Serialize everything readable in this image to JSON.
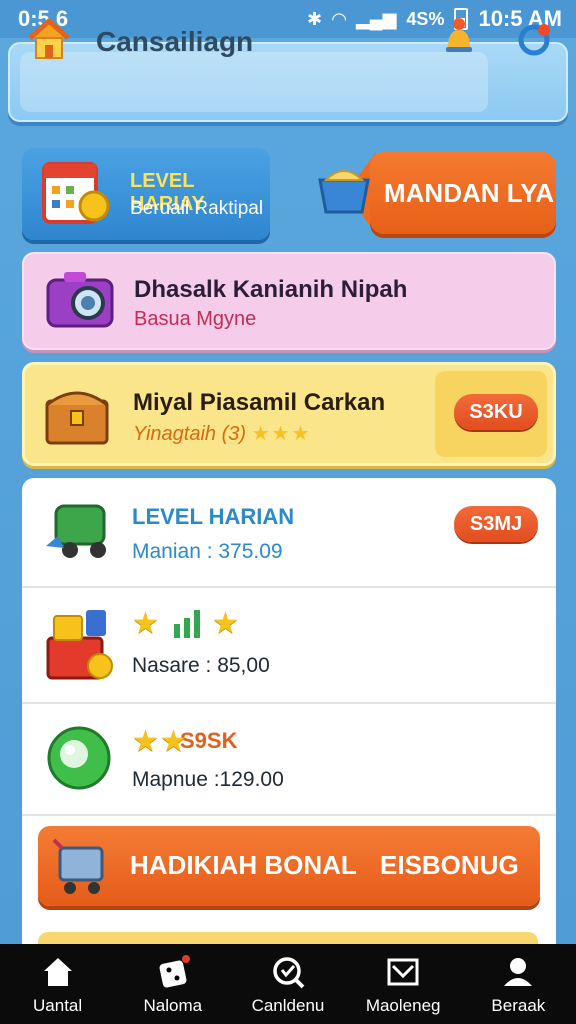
{
  "status_bar": {
    "time_left": "0:5 6",
    "battery": "4S%",
    "time_right": "10:5 AM"
  },
  "header": {
    "title": "Cansailiagn"
  },
  "level_card": {
    "title": "LEVEL HARIAY",
    "subtitle": "Beruail Raktipal"
  },
  "mandan_button": {
    "label": "MANDAN LYA"
  },
  "pink_card": {
    "title": "Dhasalk Kanianih Nipah",
    "subtitle": "Basua Mgyne"
  },
  "yellow_card": {
    "title": "Miyal Piasamil Carkan",
    "subtitle": "Yinagtaih (3)",
    "stars": 3,
    "badge": "S3KU"
  },
  "list": {
    "row1": {
      "title": "LEVEL HARIAN",
      "value": "Manian : 375.09",
      "badge": "S3MJ"
    },
    "row2": {
      "value": "Nasare : 85,00"
    },
    "row3": {
      "badge_text": "S9SK",
      "value": "Mapnue :129.00"
    },
    "banner": {
      "left": "HADIKIAH BONAL",
      "right": "EISBONUG"
    }
  },
  "colors": {
    "accent_orange": "#e85f18",
    "sky_blue": "#4f9bd6",
    "gold": "#f7c21b"
  },
  "bottom_nav": [
    {
      "icon": "home-icon",
      "label": "Uantal"
    },
    {
      "icon": "dice-icon",
      "label": "Naloma"
    },
    {
      "icon": "search-icon",
      "label": "Canldenu"
    },
    {
      "icon": "mail-icon",
      "label": "Maoleneg"
    },
    {
      "icon": "profile-icon",
      "label": "Beraak"
    }
  ]
}
